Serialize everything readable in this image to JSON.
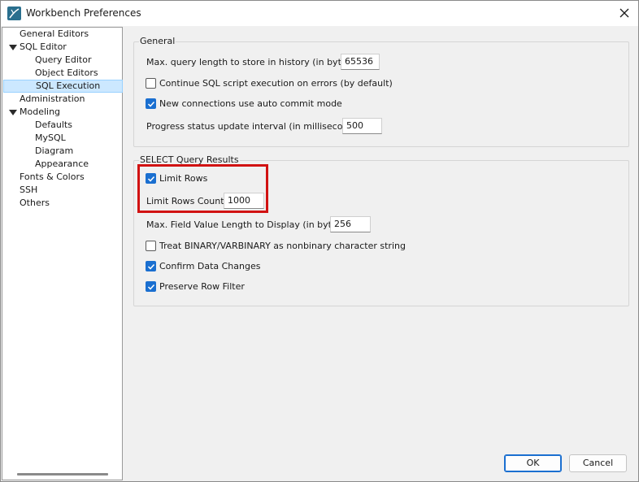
{
  "window": {
    "title": "Workbench Preferences"
  },
  "tree": {
    "items": [
      {
        "label": "General Editors"
      },
      {
        "label": "SQL Editor"
      },
      {
        "label": "Query Editor"
      },
      {
        "label": "Object Editors"
      },
      {
        "label": "SQL Execution"
      },
      {
        "label": "Administration"
      },
      {
        "label": "Modeling"
      },
      {
        "label": "Defaults"
      },
      {
        "label": "MySQL"
      },
      {
        "label": "Diagram"
      },
      {
        "label": "Appearance"
      },
      {
        "label": "Fonts & Colors"
      },
      {
        "label": "SSH"
      },
      {
        "label": "Others"
      }
    ],
    "selected": "SQL Execution"
  },
  "general": {
    "title": "General",
    "max_query_length_label": "Max. query length to store in history (in bytes):",
    "max_query_length_value": "65536",
    "continue_on_errors_label": "Continue SQL script execution on errors (by default)",
    "continue_on_errors_checked": false,
    "auto_commit_label": "New connections use auto commit mode",
    "auto_commit_checked": true,
    "progress_interval_label": "Progress status update interval (in milliseconds):",
    "progress_interval_value": "500"
  },
  "select_results": {
    "title": "SELECT Query Results",
    "limit_rows_label": "Limit Rows",
    "limit_rows_checked": true,
    "limit_rows_count_label": "Limit Rows Count:",
    "limit_rows_count_value": "1000",
    "max_field_length_label": "Max. Field Value Length to Display (in bytes):",
    "max_field_length_value": "256",
    "treat_binary_label": "Treat BINARY/VARBINARY as nonbinary character string",
    "treat_binary_checked": false,
    "confirm_changes_label": "Confirm Data Changes",
    "confirm_changes_checked": true,
    "preserve_filter_label": "Preserve Row Filter",
    "preserve_filter_checked": true
  },
  "buttons": {
    "ok": "OK",
    "cancel": "Cancel"
  },
  "colors": {
    "accent": "#1a6fd0",
    "highlight": "#d11212",
    "selection": "#cce8ff"
  }
}
